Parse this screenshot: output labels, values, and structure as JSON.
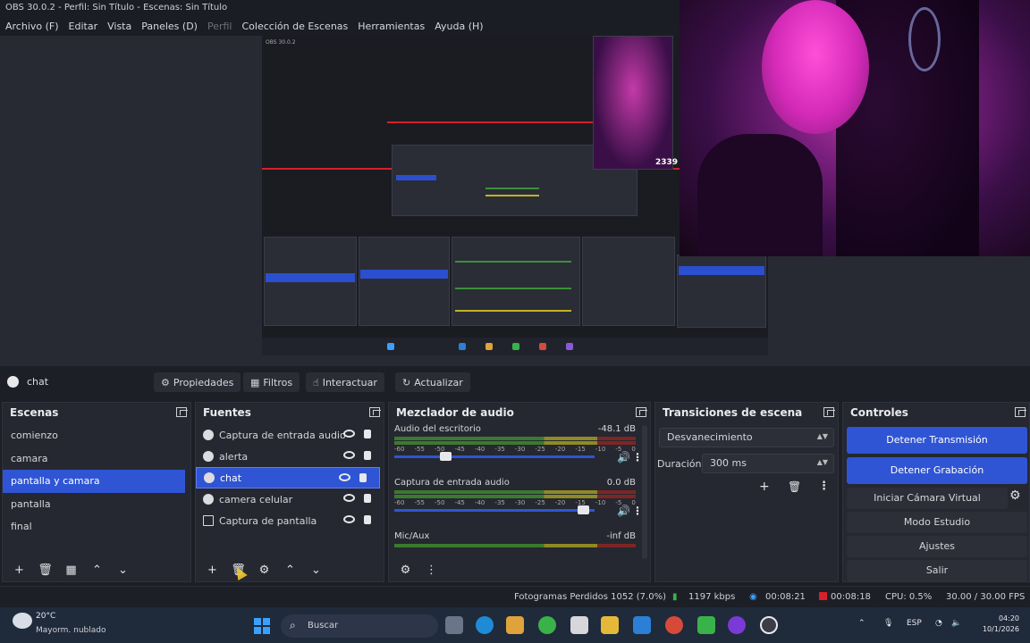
{
  "window": {
    "title": "OBS 30.0.2 - Perfil: Sin Título - Escenas: Sin Título"
  },
  "menu": {
    "items": [
      "Archivo (F)",
      "Editar",
      "Vista",
      "Paneles (D)",
      "Perfil",
      "Colección de Escenas",
      "Herramientas",
      "Ayuda (H)"
    ]
  },
  "preview": {
    "counter_text": "2339"
  },
  "source_toolbar": {
    "selected_source": "chat",
    "properties": "Propiedades",
    "filters": "Filtros",
    "interact": "Interactuar",
    "refresh": "Actualizar"
  },
  "scenes": {
    "title": "Escenas",
    "items": [
      "comienzo",
      "camara",
      "pantalla y camara",
      "pantalla",
      "final"
    ],
    "active_index": 2
  },
  "sources": {
    "title": "Fuentes",
    "items": [
      "Captura de entrada audio",
      "alerta",
      "chat",
      "camera celular",
      "Captura de pantalla"
    ],
    "active_index": 2
  },
  "mixer": {
    "title": "Mezclador de audio",
    "channels": [
      {
        "name": "Audio del escritorio",
        "db": "-48.1 dB",
        "volume": 0.24
      },
      {
        "name": "Captura de entrada audio",
        "db": "0.0 dB",
        "volume": 0.97
      },
      {
        "name": "Mic/Aux",
        "db": "-inf dB"
      }
    ],
    "ticks": [
      "-60",
      "-55",
      "-50",
      "-45",
      "-40",
      "-35",
      "-30",
      "-25",
      "-20",
      "-15",
      "-10",
      "-5",
      "0"
    ]
  },
  "transitions": {
    "title": "Transiciones de escena",
    "selected": "Desvanecimiento",
    "duration_label": "Duración",
    "duration_value": "300 ms"
  },
  "controls": {
    "title": "Controles",
    "stop_stream": "Detener Transmisión",
    "stop_record": "Detener Grabación",
    "virtual_cam": "Iniciar Cámara Virtual",
    "studio_mode": "Modo Estudio",
    "settings": "Ajustes",
    "exit": "Salir"
  },
  "status": {
    "dropped_frames": "Fotogramas Perdidos 1052 (7.0%)",
    "bitrate": "1197 kbps",
    "stream_time": "00:08:21",
    "rec_time": "00:08:18",
    "cpu": "CPU: 0.5%",
    "fps": "30.00 / 30.00 FPS"
  },
  "taskbar": {
    "weather_temp": "20°C",
    "weather_desc": "Mayorm. nublado",
    "search_placeholder": "Buscar",
    "lang": "ESP",
    "time": "04:20",
    "date": "10/1/2026"
  },
  "colors": {
    "accent": "#2f55d4",
    "panel": "#252830",
    "background": "#1d1f26",
    "recording": "#d6202a"
  }
}
